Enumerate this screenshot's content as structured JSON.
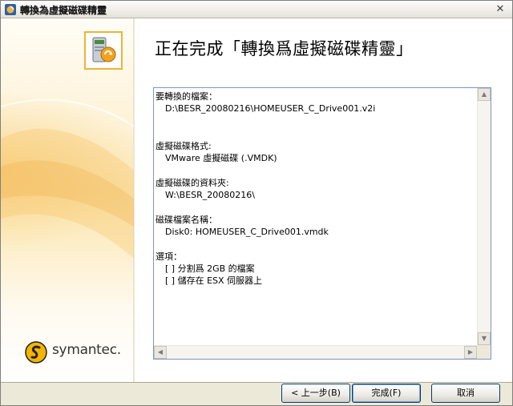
{
  "window": {
    "title": "轉換為虛擬磁碟精靈",
    "close_glyph": "✕"
  },
  "banner": {
    "brand": "symantec."
  },
  "page": {
    "heading": "正在完成「轉換爲虛擬磁碟精靈」"
  },
  "summary": {
    "sections": [
      {
        "label": "要轉換的檔案：",
        "values": [
          "D:\\BESR_20080216\\HOMEUSER_C_Drive001.v2i"
        ]
      },
      {
        "label": "虛擬磁碟格式:",
        "values": [
          "VMware 虛擬磁碟 (.VMDK)"
        ]
      },
      {
        "label": "虛擬磁碟的資料夾:",
        "values": [
          "W:\\BESR_20080216\\"
        ]
      },
      {
        "label": "磁碟檔案名稱：",
        "values": [
          "Disk0: HOMEUSER_C_Drive001.vmdk"
        ]
      },
      {
        "label": "選項：",
        "values": [
          "[ ] 分割爲 2GB 的檔案",
          "[ ] 儲存在 ESX 伺服器上"
        ]
      }
    ]
  },
  "buttons": {
    "back": "< 上一步(B)",
    "finish": "完成(F)",
    "cancel": "取消"
  },
  "icons": {
    "title": "wizard-app-icon",
    "wizard": "disk-convert-icon",
    "logo": "symantec-logo-icon"
  },
  "colors": {
    "accent_border": "#f2b233",
    "button_border": "#003c74"
  }
}
